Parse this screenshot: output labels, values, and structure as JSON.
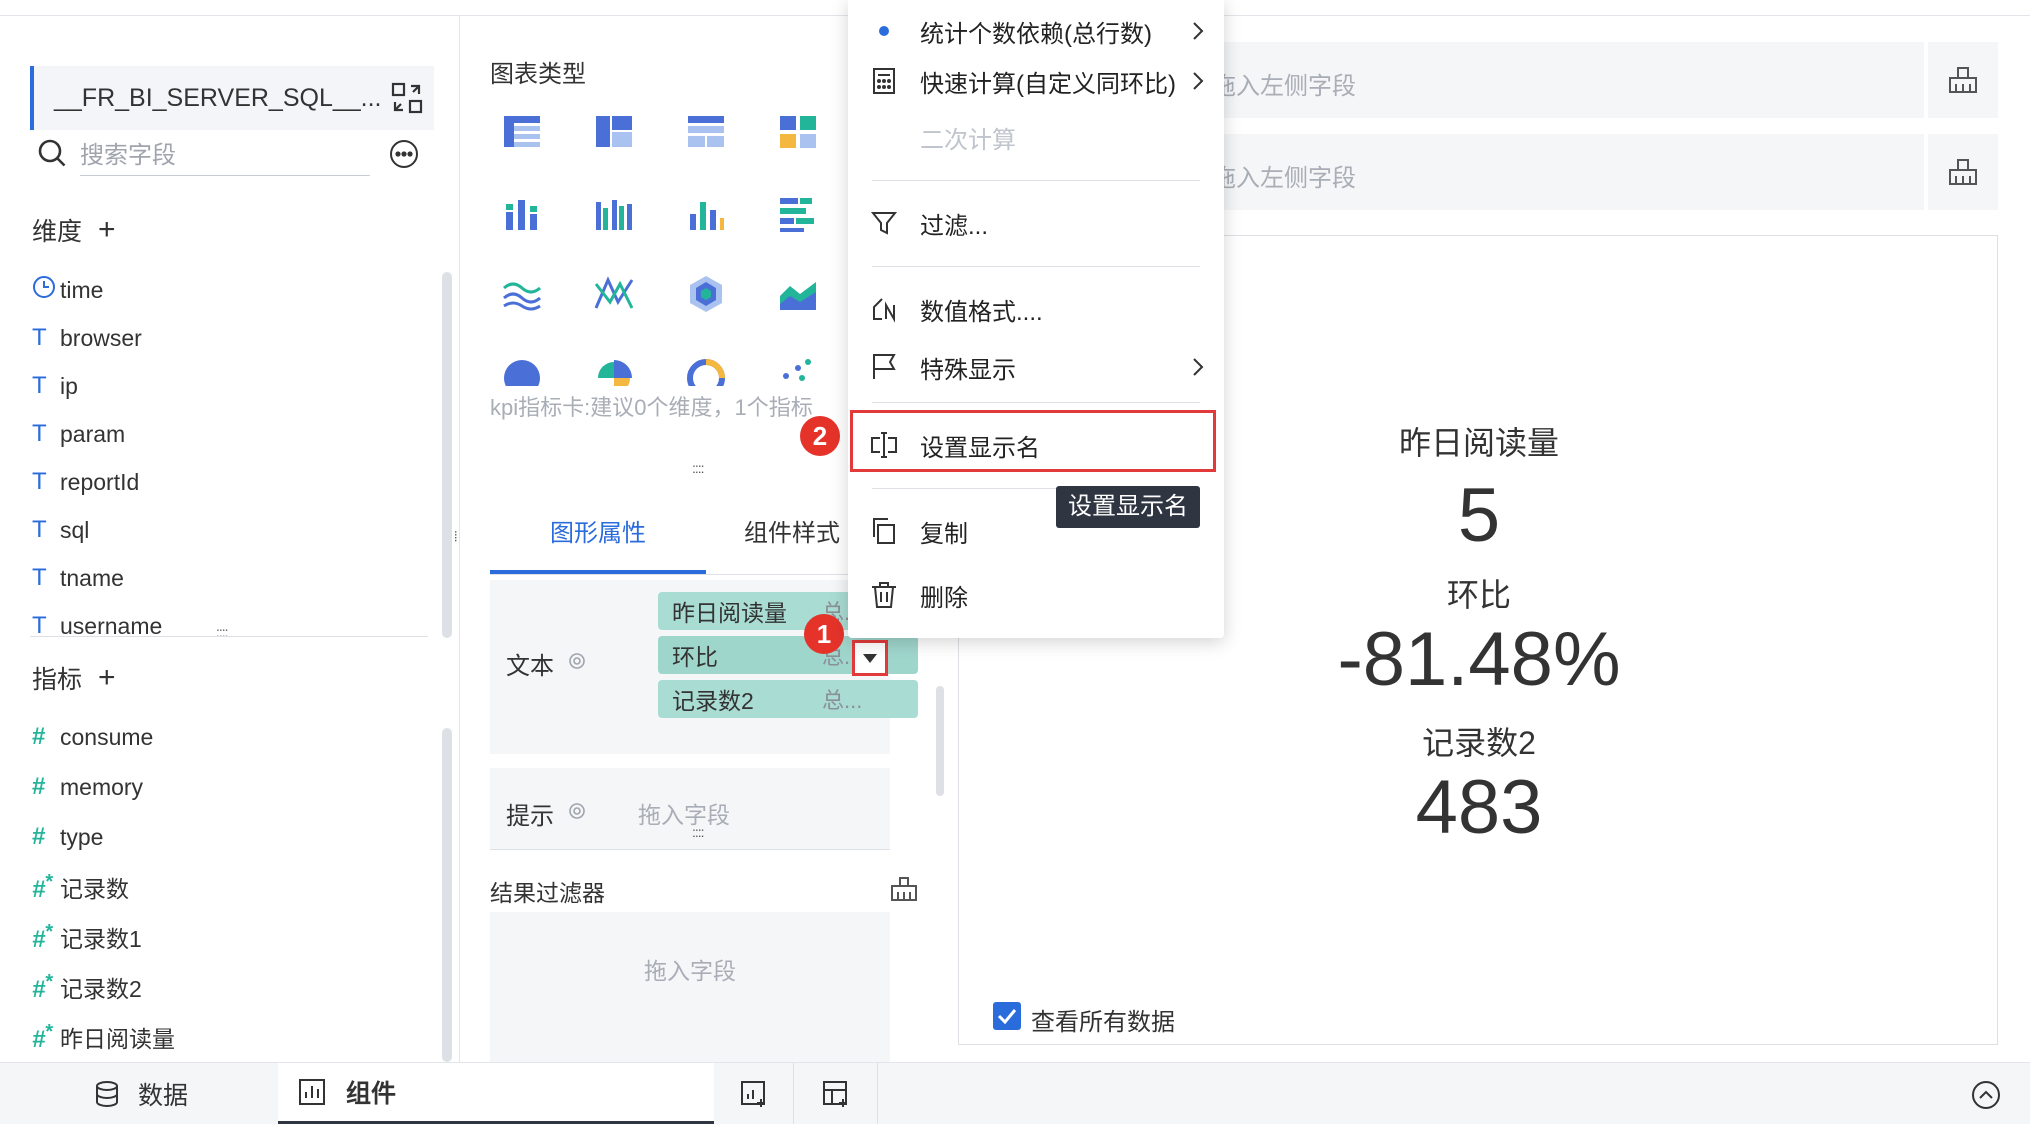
{
  "datasource": {
    "name": "__FR_BI_SERVER_SQL__..."
  },
  "search": {
    "placeholder": "搜索字段"
  },
  "dimensions": {
    "title": "维度",
    "fields": [
      {
        "name": "time",
        "icon": "clock-icon"
      },
      {
        "name": "browser",
        "icon": "text-type-icon"
      },
      {
        "name": "ip",
        "icon": "text-type-icon"
      },
      {
        "name": "param",
        "icon": "text-type-icon"
      },
      {
        "name": "reportId",
        "icon": "text-type-icon"
      },
      {
        "name": "sql",
        "icon": "text-type-icon"
      },
      {
        "name": "tname",
        "icon": "text-type-icon"
      },
      {
        "name": "username",
        "icon": "text-type-icon"
      }
    ]
  },
  "measures": {
    "title": "指标",
    "fields": [
      {
        "name": "consume",
        "icon": "number-icon"
      },
      {
        "name": "memory",
        "icon": "number-icon"
      },
      {
        "name": "type",
        "icon": "number-icon"
      },
      {
        "name": "记录数",
        "icon": "calc-number-icon"
      },
      {
        "name": "记录数1",
        "icon": "calc-number-icon"
      },
      {
        "name": "记录数2",
        "icon": "calc-number-icon"
      },
      {
        "name": "昨日阅读量",
        "icon": "calc-number-icon"
      }
    ]
  },
  "chart_type": {
    "title": "图表类型",
    "hint": "kpi指标卡:建议0个维度，1个指标"
  },
  "tabs": [
    {
      "label": "图形属性",
      "active": true
    },
    {
      "label": "组件样式",
      "active": false
    }
  ],
  "text_section": {
    "label": "文本",
    "pills": [
      {
        "name": "昨日阅读量",
        "agg": "总..."
      },
      {
        "name": "环比",
        "agg": "总..."
      },
      {
        "name": "记录数2",
        "agg": "总..."
      }
    ]
  },
  "tooltip_section": {
    "label": "提示",
    "placeholder": "拖入字段"
  },
  "result_filter": {
    "title": "结果过滤器",
    "placeholder": "拖入字段"
  },
  "axis_drop": {
    "placeholder": "拖入左侧字段"
  },
  "kpi": [
    {
      "label": "昨日阅读量",
      "value": "5"
    },
    {
      "label": "环比",
      "value": "-81.48%"
    },
    {
      "label": "记录数2",
      "value": "483"
    }
  ],
  "view_all": {
    "label": "查看所有数据",
    "checked": true
  },
  "context_menu": {
    "items": [
      {
        "label": "统计个数依赖(总行数)",
        "icon": "bullet-icon",
        "submenu": true
      },
      {
        "label": "快速计算(自定义同环比)",
        "icon": "calculator-icon",
        "submenu": true
      },
      {
        "label": "二次计算",
        "icon": "",
        "disabled": true
      },
      {
        "label": "过滤...",
        "icon": "filter-icon"
      },
      {
        "label": "数值格式....",
        "icon": "number-format-icon"
      },
      {
        "label": "特殊显示",
        "icon": "flag-icon",
        "submenu": true
      },
      {
        "label": "设置显示名",
        "icon": "rename-icon"
      },
      {
        "label": "复制",
        "icon": "copy-icon"
      },
      {
        "label": "删除",
        "icon": "trash-icon"
      }
    ]
  },
  "tooltip": {
    "text": "设置显示名"
  },
  "badges": [
    "1",
    "2"
  ],
  "bottom_tabs": [
    {
      "label": "数据"
    },
    {
      "label": "组件"
    }
  ],
  "colors": {
    "accent": "#2b6cdc",
    "teal": "#22b59a",
    "pill": "#a9dcd3",
    "highlight": "#e23a3a"
  }
}
